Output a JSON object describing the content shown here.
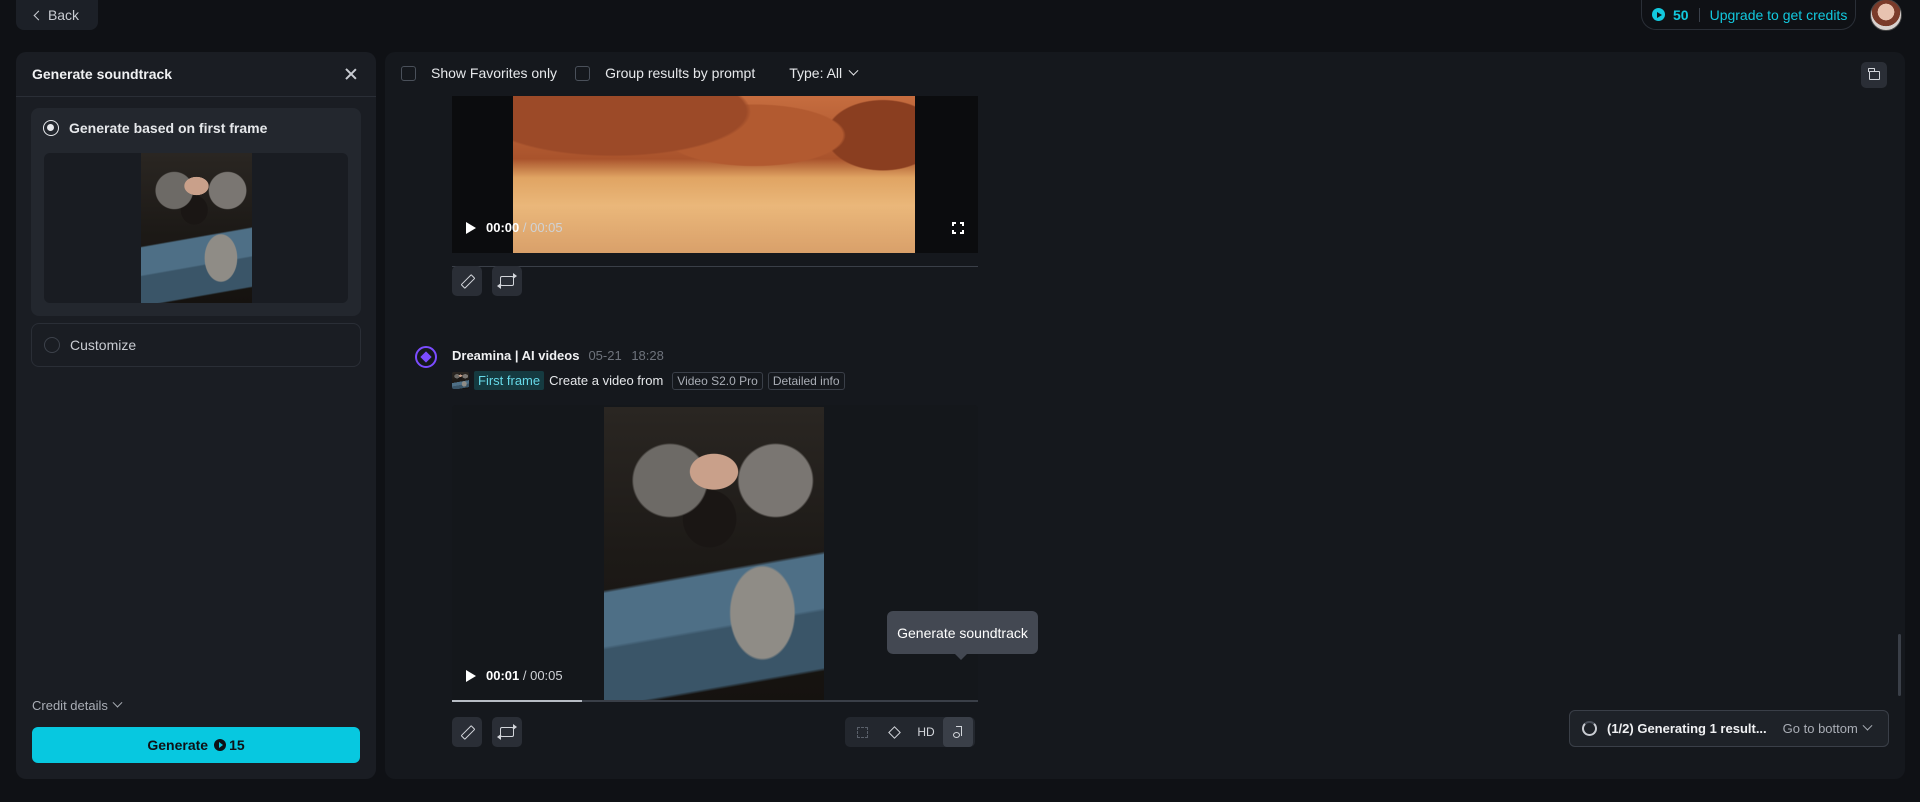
{
  "topbar": {
    "back_label": "Back",
    "credits_count": "50",
    "upgrade_label": "Upgrade to get credits"
  },
  "left_panel": {
    "title": "Generate soundtrack",
    "option_first_frame": "Generate based on first frame",
    "option_customize": "Customize",
    "selected_option": "first_frame",
    "credit_details_label": "Credit details",
    "generate_label": "Generate",
    "generate_cost": "15"
  },
  "toolbar": {
    "show_favorites_label": "Show Favorites only",
    "group_results_label": "Group results by prompt",
    "type_filter_label": "Type: All"
  },
  "video1": {
    "current_time": "00:00",
    "duration": "/ 00:05"
  },
  "post": {
    "author": "Dreamina | AI videos",
    "date": "05-21",
    "time": "18:28",
    "first_frame_tag": "First frame",
    "prompt_text": "Create a video from",
    "model_tag": "Video S2.0 Pro",
    "info_tag": "Detailed info"
  },
  "video2": {
    "current_time": "00:01",
    "duration": "/ 00:05",
    "progress_fraction": 0.247
  },
  "actions": {
    "hd_label": "HD",
    "tooltip": "Generate soundtrack"
  },
  "status": {
    "text": "(1/2) Generating 1 result...",
    "go_bottom_label": "Go to bottom"
  },
  "colors": {
    "accent": "#07c8e0",
    "brand_purple": "#7b4cff",
    "background": "#0f1115"
  }
}
